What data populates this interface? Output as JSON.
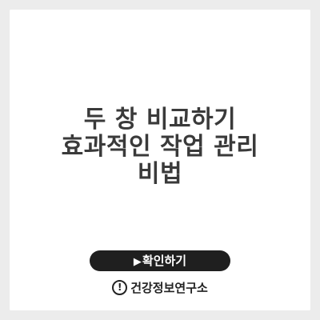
{
  "title": {
    "lines": [
      "두 창 비교하기",
      "효과적인 작업 관리",
      "비법"
    ]
  },
  "confirm_button": {
    "icon": "play-triangle-icon",
    "label": "확인하기",
    "icon_glyph": "▶"
  },
  "brand": {
    "icon": "info-circle-icon",
    "icon_glyph": "!",
    "name": "건강정보연구소"
  },
  "colors": {
    "background": "#ececec",
    "card": "#ffffff",
    "title_text": "#3a3a3a",
    "button_bg": "#1f1f1f",
    "button_text": "#ffffff"
  }
}
